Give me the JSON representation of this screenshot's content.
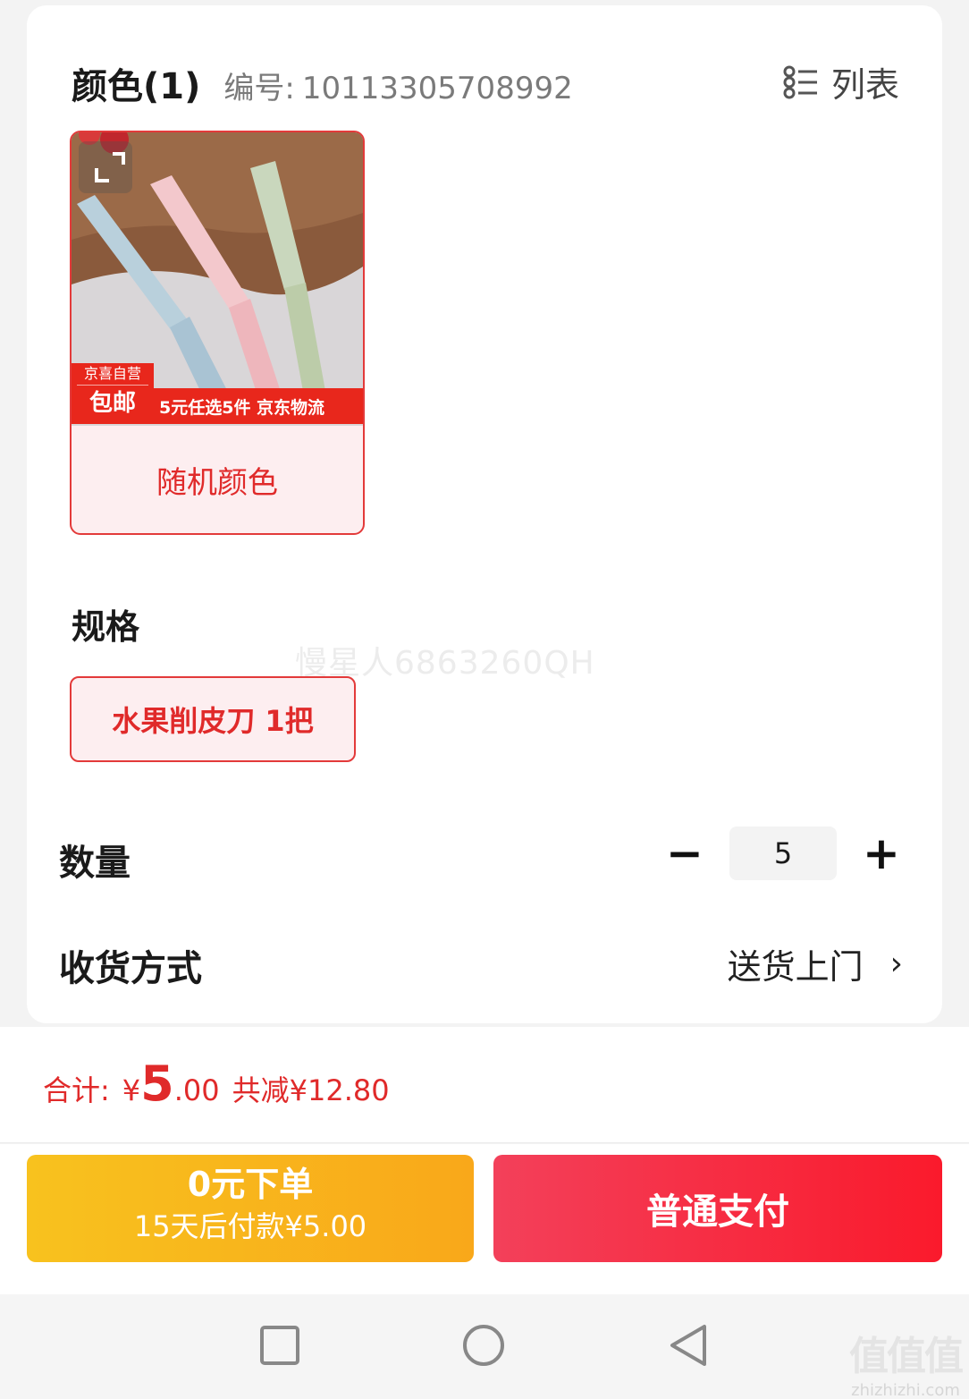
{
  "color_section": {
    "title": "颜色(1)",
    "sku_label": "编号:",
    "sku_value": "10113305708992",
    "view_toggle_label": "列表"
  },
  "product_tile": {
    "name": "随机颜色",
    "badge_top": "京喜自营",
    "badge_bottom": "包邮",
    "promo_text": "5元任选5件 京东物流",
    "selected": true
  },
  "spec_section": {
    "title": "规格",
    "options": [
      {
        "label": "水果削皮刀 1把",
        "selected": true
      }
    ]
  },
  "user_watermark": "慢星人6863260QH",
  "quantity": {
    "label": "数量",
    "value": "5",
    "minus_symbol": "−",
    "plus_symbol": "+"
  },
  "shipping": {
    "label": "收货方式",
    "value": "送货上门",
    "chevron": "›"
  },
  "total": {
    "label": "合计:",
    "currency": "¥",
    "amount_int": "5",
    "amount_dec": ".00",
    "savings": "共减¥12.80"
  },
  "actions": {
    "zero_order_title": "0元下单",
    "zero_order_subtitle": "15天后付款¥5.00",
    "pay_label": "普通支付"
  },
  "site_watermark": {
    "logo": "值值值",
    "url": "zhizhizhi.com"
  },
  "colors": {
    "accent_red": "#e02a2a",
    "pay_button": "#fa1a2c",
    "zero_button": "#f9b51d",
    "selected_bg": "#fdeef0"
  },
  "icons": [
    "list-view-icon",
    "expand-icon",
    "minus-icon",
    "plus-icon",
    "chevron-right-icon",
    "nav-square-icon",
    "nav-circle-icon",
    "nav-back-icon"
  ]
}
